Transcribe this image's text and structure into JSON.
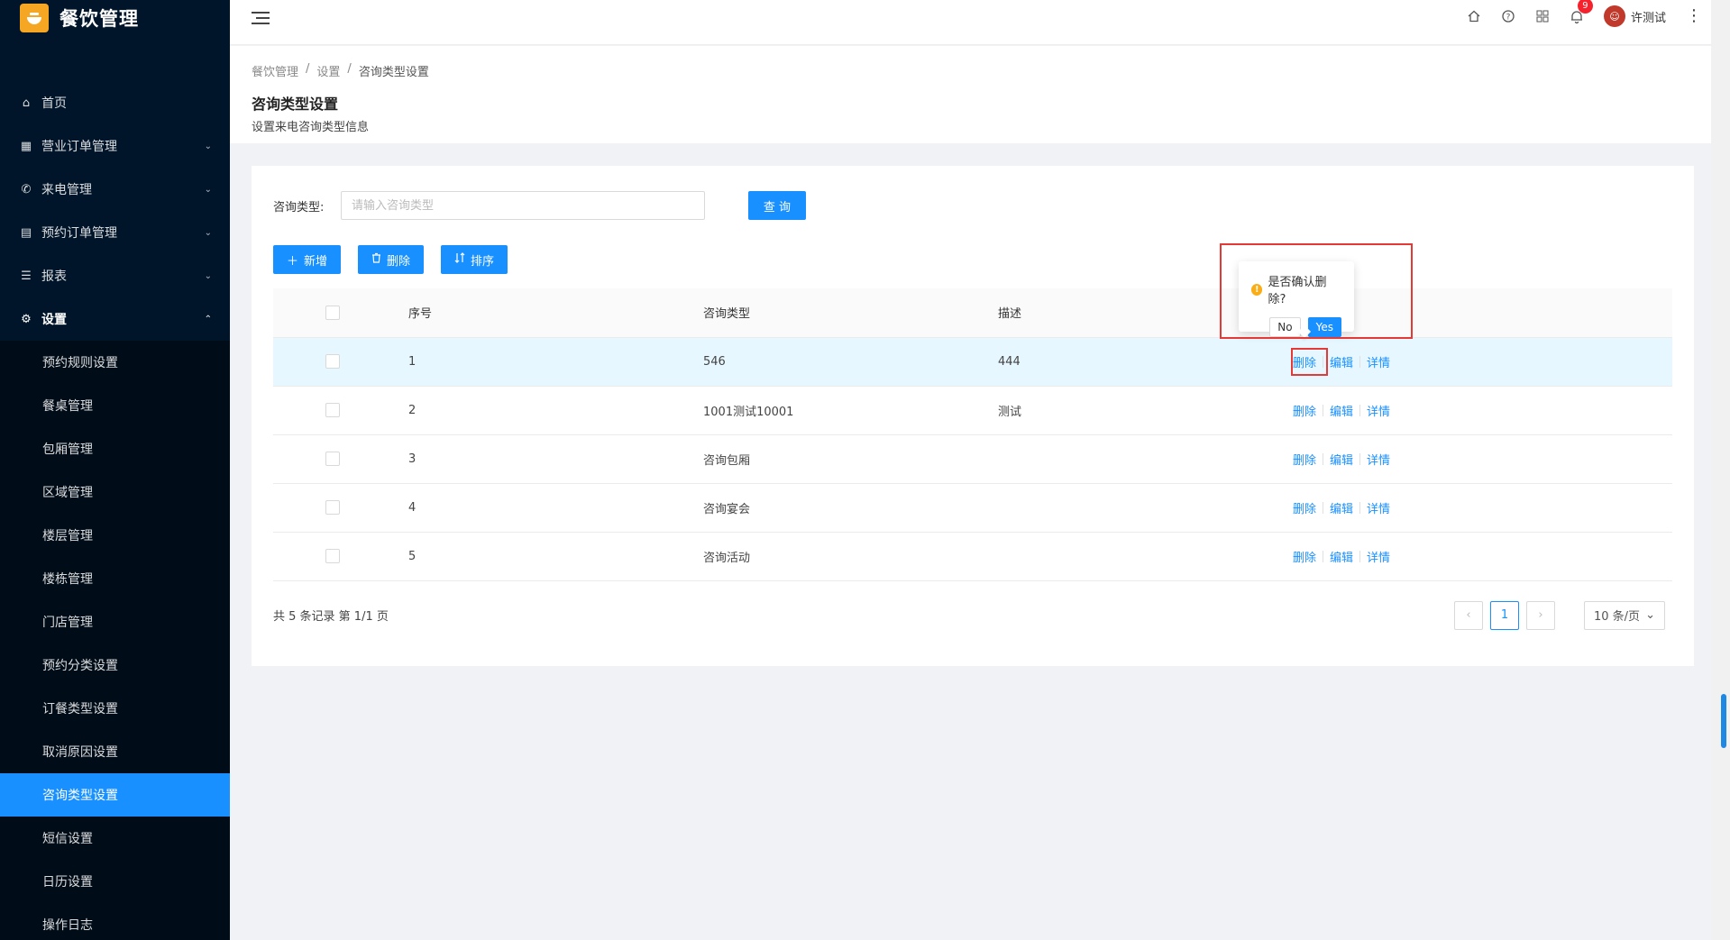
{
  "app": {
    "title": "餐饮管理"
  },
  "sidebar": {
    "menu": [
      {
        "label": "首页",
        "icon": "home-icon",
        "glyph": "⌂",
        "arrow": ""
      },
      {
        "label": "营业订单管理",
        "icon": "calendar-icon",
        "glyph": "▦",
        "arrow": "⌄"
      },
      {
        "label": "来电管理",
        "icon": "phone-icon",
        "glyph": "✆",
        "arrow": "⌄"
      },
      {
        "label": "预约订单管理",
        "icon": "list-icon",
        "glyph": "▤",
        "arrow": "⌄"
      },
      {
        "label": "报表",
        "icon": "menu-icon",
        "glyph": "☰",
        "arrow": "⌄"
      },
      {
        "label": "设置",
        "icon": "gear-icon",
        "glyph": "⚙",
        "arrow": "⌃"
      }
    ],
    "submenu": [
      "预约规则设置",
      "餐桌管理",
      "包厢管理",
      "区域管理",
      "楼层管理",
      "楼栋管理",
      "门店管理",
      "预约分类设置",
      "订餐类型设置",
      "取消原因设置",
      "咨询类型设置",
      "短信设置",
      "日历设置",
      "操作日志"
    ]
  },
  "header": {
    "notification_count": "9",
    "user_name": "许测试"
  },
  "breadcrumb": [
    "餐饮管理",
    "/",
    "设置",
    "/",
    "咨询类型设置"
  ],
  "page": {
    "title": "咨询类型设置",
    "description": "设置来电咨询类型信息"
  },
  "search": {
    "label": "咨询类型:",
    "placeholder": "请输入咨询类型",
    "button": "查 询"
  },
  "toolbar": {
    "add": "新增",
    "delete": "删除",
    "sort": "排序"
  },
  "table": {
    "columns": [
      "序号",
      "咨询类型",
      "描述"
    ],
    "rows": [
      {
        "idx": "1",
        "type": "546",
        "desc": "444"
      },
      {
        "idx": "2",
        "type": "1001测试10001",
        "desc": "测试"
      },
      {
        "idx": "3",
        "type": "咨询包厢",
        "desc": ""
      },
      {
        "idx": "4",
        "type": "咨询宴会",
        "desc": ""
      },
      {
        "idx": "5",
        "type": "咨询活动",
        "desc": ""
      }
    ],
    "actions": {
      "delete": "删除",
      "edit": "编辑",
      "detail": "详情"
    }
  },
  "pagination": {
    "summary": "共 5 条记录 第 1/1 页",
    "current": "1",
    "page_size": "10 条/页"
  },
  "popconfirm": {
    "title": "是否确认删除?",
    "no": "No",
    "yes": "Yes"
  },
  "colors": {
    "primary": "#1890ff",
    "sidebar_bg": "#001529",
    "annotation": "#e53935"
  }
}
